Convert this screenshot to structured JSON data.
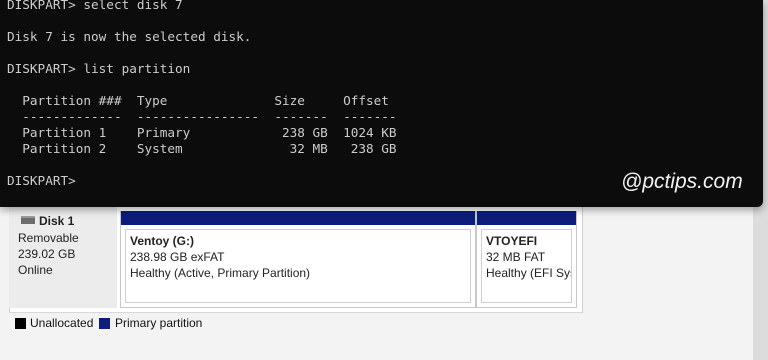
{
  "terminal": {
    "lines": [
      "DISKPART> select disk 7",
      "",
      "Disk 7 is now the selected disk.",
      "",
      "DISKPART> list partition",
      "",
      "  Partition ###  Type              Size     Offset",
      "  -------------  ----------------  -------  -------",
      "  Partition 1    Primary            238 GB  1024 KB",
      "  Partition 2    System              32 MB   238 GB",
      "",
      "DISKPART> "
    ],
    "watermark": "@pctips.com"
  },
  "disk_management": {
    "disk": {
      "name": "Disk 1",
      "type": "Removable",
      "size": "239.02 GB",
      "status": "Online",
      "icon": "disk-icon"
    },
    "partitions": [
      {
        "name": "Ventoy  (G:)",
        "fs": "238.98 GB exFAT",
        "health": "Healthy (Active, Primary Partition)",
        "color": "#0c1d7c"
      },
      {
        "name": "VTOYEFI",
        "fs": "32 MB FAT",
        "health": "Healthy (EFI Sys",
        "color": "#0c1d7c"
      }
    ],
    "legend": [
      {
        "label": "Unallocated",
        "color": "#000000"
      },
      {
        "label": "Primary partition",
        "color": "#0c1d7c"
      }
    ]
  }
}
